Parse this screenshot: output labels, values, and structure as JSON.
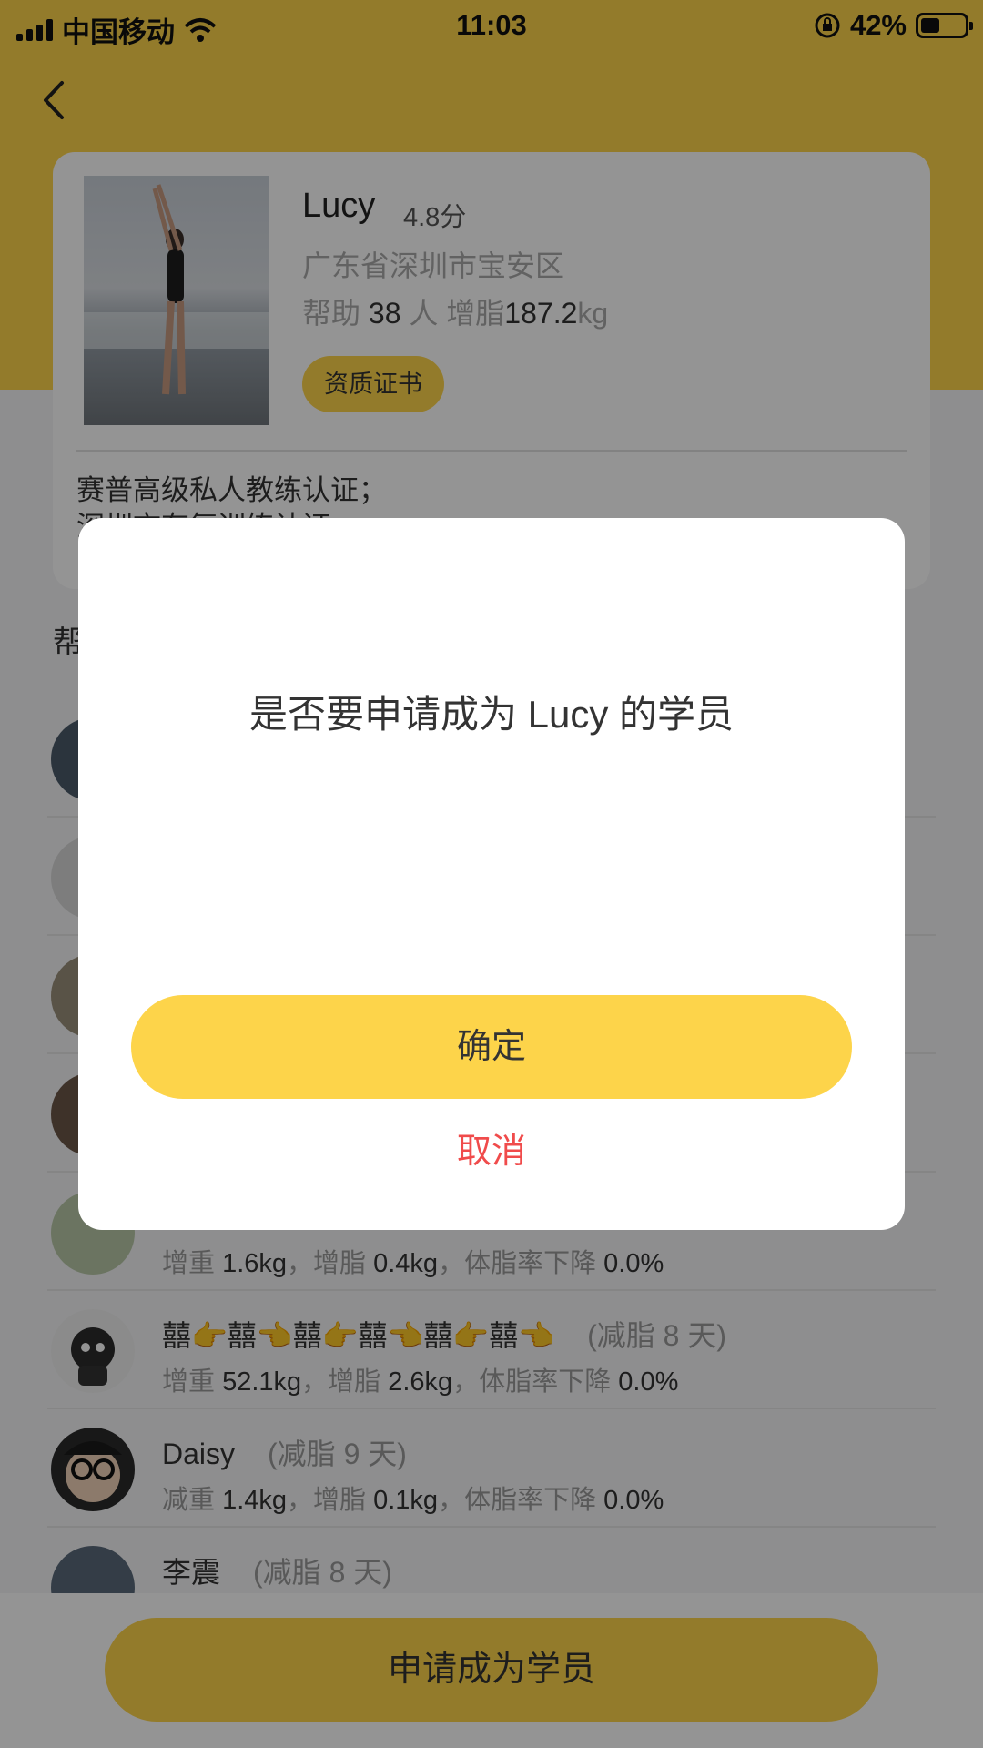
{
  "status_bar": {
    "carrier": "中国移动",
    "time": "11:03",
    "battery": "42%"
  },
  "coach": {
    "name": "Lucy",
    "score": "4.8分",
    "location": "广东省深圳市宝安区",
    "stats_prefix": "帮助",
    "helped_count": "38",
    "stats_mid": "人 增脂",
    "fat_value": "187.2",
    "fat_unit": "kg",
    "cert_button": "资质证书",
    "description_line1": "赛普高级私人教练认证；",
    "description_line2": "深圳市有氧训练认证"
  },
  "section_title": "帮",
  "students": [
    {
      "name": "",
      "days": "",
      "m1_label": "",
      "m1": "",
      "m2_label": "",
      "m2": "",
      "m3_label": "",
      "m3": ""
    },
    {
      "name": "",
      "days": "",
      "m1_label": "",
      "m1": "",
      "m2_label": "",
      "m2": "",
      "m3_label": "",
      "m3": ""
    },
    {
      "name": "",
      "days": "",
      "m1_label": "",
      "m1": "",
      "m2_label": "",
      "m2": "",
      "m3_label": "",
      "m3": ""
    },
    {
      "name": "",
      "days": "",
      "m1_label": "",
      "m1": "",
      "m2_label": "",
      "m2": "",
      "m3_label": "",
      "m3": ""
    },
    {
      "name": "",
      "days": "",
      "m1_label": "增重",
      "m1": "1.6kg",
      "m2_label": "，增脂",
      "m2": "0.4kg",
      "m3_label": "，体脂率下降",
      "m3": "0.0%"
    },
    {
      "name": "囍👉囍👈囍👉囍👈囍👉囍👈",
      "days": "(减脂 8 天)",
      "m1_label": "增重",
      "m1": "52.1kg",
      "m2_label": "，增脂",
      "m2": "2.6kg",
      "m3_label": "，体脂率下降",
      "m3": "0.0%"
    },
    {
      "name": "Daisy",
      "days": "(减脂 9 天)",
      "m1_label": "减重",
      "m1": "1.4kg",
      "m2_label": "，增脂",
      "m2": "0.1kg",
      "m3_label": "，体脂率下降",
      "m3": "0.0%"
    },
    {
      "name": "李震",
      "days": "(减脂 8 天)",
      "m1_label": "",
      "m1": "",
      "m2_label": "",
      "m2": "",
      "m3_label": "",
      "m3": ""
    }
  ],
  "apply_button": "申请成为学员",
  "dialog": {
    "message": "是否要申请成为 Lucy 的学员",
    "confirm": "确定",
    "cancel": "取消"
  },
  "colors": {
    "accent": "#fdd44a",
    "cancel_red": "#f04b4b"
  }
}
